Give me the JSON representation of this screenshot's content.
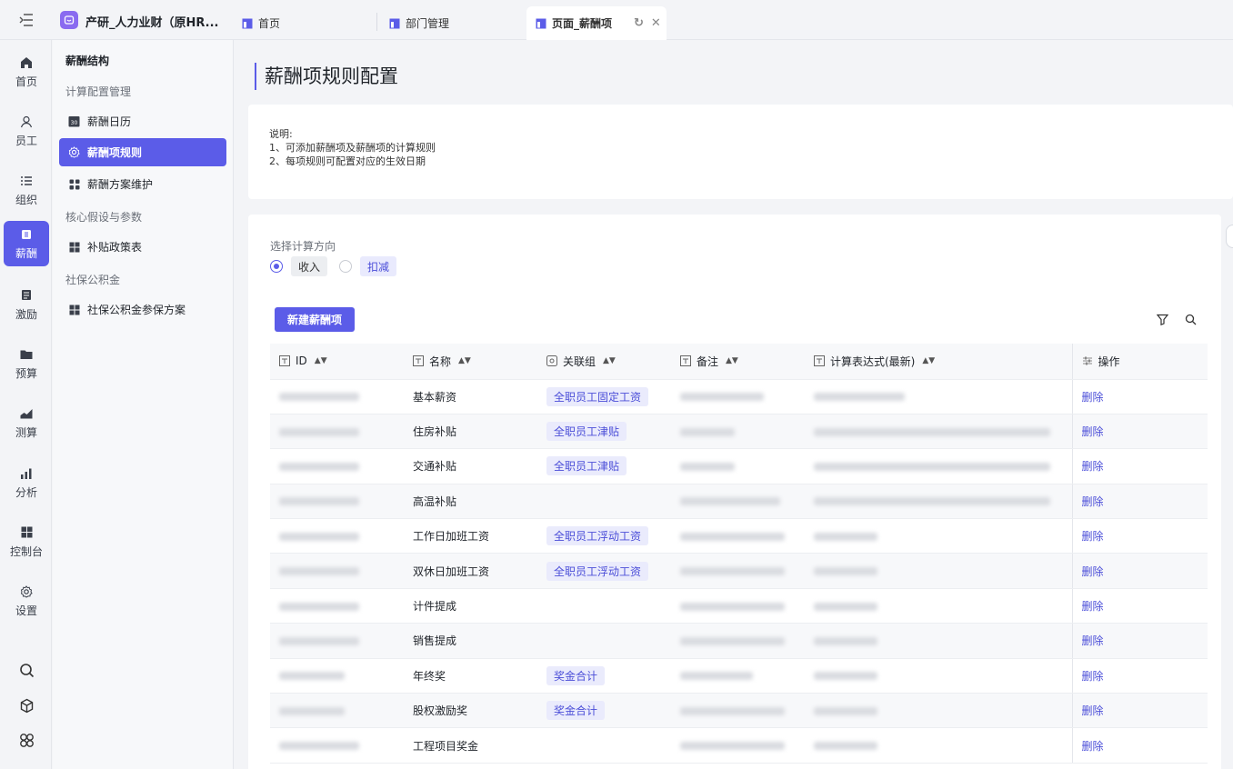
{
  "app": {
    "name": "产研_人力业财（原HR..."
  },
  "tabs": [
    {
      "label": "首页",
      "active": false
    },
    {
      "label": "部门管理",
      "active": false
    },
    {
      "label": "页面_薪酬项",
      "active": true
    }
  ],
  "rail": [
    {
      "label": "首页",
      "icon": "home-icon"
    },
    {
      "label": "员工",
      "icon": "user-icon"
    },
    {
      "label": "组织",
      "icon": "list-icon"
    },
    {
      "label": "薪酬",
      "icon": "salary-icon",
      "active": true
    },
    {
      "label": "激励",
      "icon": "incentive-icon"
    },
    {
      "label": "预算",
      "icon": "folder-icon"
    },
    {
      "label": "测算",
      "icon": "area-chart-icon"
    },
    {
      "label": "分析",
      "icon": "bar-chart-icon"
    },
    {
      "label": "控制台",
      "icon": "grid-icon"
    },
    {
      "label": "设置",
      "icon": "gear-icon"
    }
  ],
  "subnav": {
    "title": "薪酬结构",
    "group1": "计算配置管理",
    "item_calendar": "薪酬日历",
    "item_rules": "薪酬项规则",
    "item_plan": "薪酬方案维护",
    "group2": "核心假设与参数",
    "item_subsidy": "补贴政策表",
    "group3": "社保公积金",
    "item_social": "社保公积金参保方案"
  },
  "page": {
    "title": "薪酬项规则配置",
    "note_heading": "说明:",
    "note_line1": "1、可添加薪酬项及薪酬项的计算规则",
    "note_line2": "2、每项规则可配置对应的生效日期",
    "direction_label": "选择计算方向",
    "radio_income": "收入",
    "radio_deduct": "扣减",
    "new_button": "新建薪酬项"
  },
  "table": {
    "headers": {
      "id": "ID",
      "name": "名称",
      "group": "关联组",
      "remark": "备注",
      "expr": "计算表达式(最新)",
      "op": "操作"
    },
    "delete_label": "删除",
    "rows": [
      {
        "name": "基本薪资",
        "group": "全职员工固定工资"
      },
      {
        "name": "住房补贴",
        "group": "全职员工津贴"
      },
      {
        "name": "交通补贴",
        "group": "全职员工津贴"
      },
      {
        "name": "高温补贴",
        "group": ""
      },
      {
        "name": "工作日加班工资",
        "group": "全职员工浮动工资"
      },
      {
        "name": "双休日加班工资",
        "group": "全职员工浮动工资"
      },
      {
        "name": "计件提成",
        "group": ""
      },
      {
        "name": "销售提成",
        "group": ""
      },
      {
        "name": "年终奖",
        "group": "奖金合计"
      },
      {
        "name": "股权激励奖",
        "group": "奖金合计"
      },
      {
        "name": "工程项目奖金",
        "group": ""
      }
    ]
  },
  "colors": {
    "accent": "#5b5ce8",
    "tag_bg": "#eaebfc",
    "link": "#4b4ed8"
  }
}
